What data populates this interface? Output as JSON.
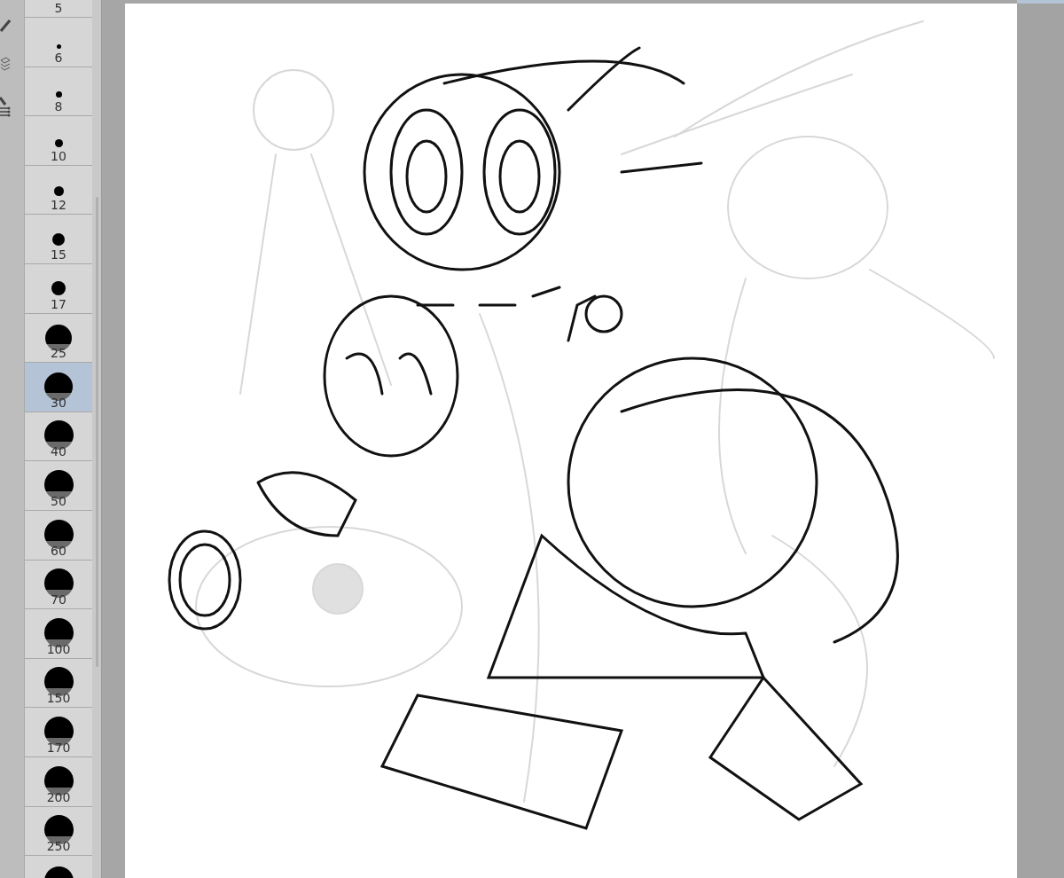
{
  "brush_sizes": [
    {
      "kind": "label-only",
      "label": "5",
      "selected": false
    },
    {
      "kind": "dot",
      "label": "6",
      "selected": false
    },
    {
      "kind": "dot",
      "label": "8",
      "selected": false
    },
    {
      "kind": "dot",
      "label": "10",
      "selected": false
    },
    {
      "kind": "dot",
      "label": "12",
      "selected": false
    },
    {
      "kind": "dot",
      "label": "15",
      "selected": false
    },
    {
      "kind": "dot",
      "label": "17",
      "selected": false
    },
    {
      "kind": "dot",
      "label": "25",
      "selected": false
    },
    {
      "kind": "dot",
      "label": "30",
      "selected": true
    },
    {
      "kind": "dot",
      "label": "40",
      "selected": false
    },
    {
      "kind": "dot",
      "label": "50",
      "selected": false
    },
    {
      "kind": "dot",
      "label": "60",
      "selected": false
    },
    {
      "kind": "dot",
      "label": "70",
      "selected": false
    },
    {
      "kind": "dot",
      "label": "100",
      "selected": false
    },
    {
      "kind": "dot",
      "label": "150",
      "selected": false
    },
    {
      "kind": "dot",
      "label": "170",
      "selected": false
    },
    {
      "kind": "dot",
      "label": "200",
      "selected": false
    },
    {
      "kind": "dot",
      "label": "250",
      "selected": false
    },
    {
      "kind": "dot-only",
      "selected": false
    }
  ]
}
